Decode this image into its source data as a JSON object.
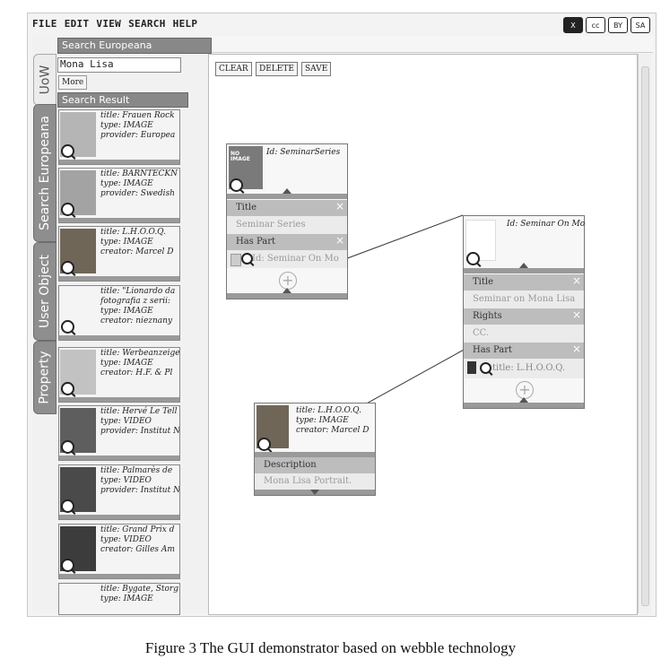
{
  "menu": [
    "FILE",
    "EDIT",
    "VIEW",
    "SEARCH",
    "HELP"
  ],
  "license_icons": [
    "X",
    "cc",
    "BY",
    "SA"
  ],
  "side_tabs": [
    "UoW",
    "Search Europeana",
    "User Object",
    "Property"
  ],
  "search": {
    "header": "Search Europeana",
    "query": "Mona Lisa",
    "more_label": "More",
    "results_header": "Search Result"
  },
  "results": [
    {
      "l1": "title: Frauen Rock",
      "l2": "type: IMAGE",
      "l3": "provider: Europea"
    },
    {
      "l1": "title: BARNTECKN",
      "l2": "type: IMAGE",
      "l3": "provider: Swedish"
    },
    {
      "l1": "title: L.H.O.O.Q.",
      "l2": "type: IMAGE",
      "l3": "creator: Marcel D"
    },
    {
      "l1": "title: \"Lionardo da",
      "l2": "fotografia z serii:",
      "l3": "type: IMAGE",
      "l4": "creator: nieznany"
    },
    {
      "l1": "title: Werbeanzeige",
      "l2": "type: IMAGE",
      "l3": "creator: H.F. & Pl"
    },
    {
      "l1": "title: Hervé Le Tell",
      "l2": "type: VIDEO",
      "l3": "provider: Institut N"
    },
    {
      "l1": "title: Palmarès de",
      "l2": "type: VIDEO",
      "l3": "provider: Institut N"
    },
    {
      "l1": "title: Grand Prix d",
      "l2": "type: VIDEO",
      "l3": "creator: Gilles Am"
    },
    {
      "l1": "title: Bygate, Storg",
      "l2": "type: IMAGE"
    }
  ],
  "toolbar": {
    "clear": "CLEAR",
    "delete": "DELETE",
    "save": "SAVE"
  },
  "card1": {
    "thumb_text": "NO IMAGE",
    "id": "Id: SeminarSeries",
    "title_label": "Title",
    "title_value": "Seminar Series",
    "haspart_label": "Has Part",
    "haspart_value": "Id: Seminar On Mo"
  },
  "card2": {
    "id": "Id: Seminar On Mo",
    "title_label": "Title",
    "title_value": "Seminar on Mona Lisa",
    "rights_label": "Rights",
    "rights_value": "CC.",
    "haspart_label": "Has Part",
    "haspart_value": "title: L.H.O.O.Q."
  },
  "card3": {
    "l1": "title: L.H.O.O.Q.",
    "l2": "type: IMAGE",
    "l3": "creator: Marcel D",
    "desc_label": "Description",
    "desc_value": "Mona Lisa Portrait."
  },
  "caption": "Figure 3 The GUI demonstrator based on webble technology"
}
